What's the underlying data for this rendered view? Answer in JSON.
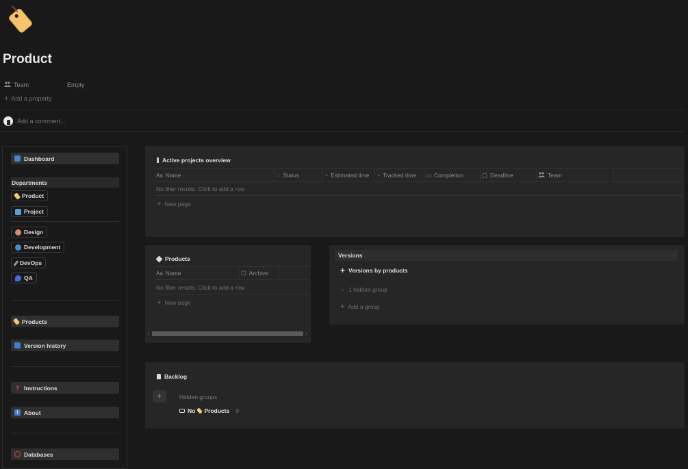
{
  "page": {
    "icon": "tag-icon",
    "title": "Product",
    "properties": [
      {
        "label": "Team",
        "value": "Empty",
        "icon": "people-icon"
      }
    ],
    "add_property": "Add a property",
    "comment_placeholder": "Add a comment..."
  },
  "sidebar": {
    "dashboard": "Dashboard",
    "departments_label": "Departments",
    "departments": [
      {
        "label": "Product",
        "icon": "tag-icon"
      },
      {
        "label": "Project",
        "icon": "chart-icon"
      },
      {
        "label": "Design",
        "icon": "palette-icon"
      },
      {
        "label": "Development",
        "icon": "globe-icon"
      },
      {
        "label": "DevOps",
        "icon": "wrench-icon"
      },
      {
        "label": "QA",
        "icon": "pin-icon"
      }
    ],
    "products": "Products",
    "version_history": "Version history",
    "instructions": "Instructions",
    "about": "About",
    "databases": "Databases"
  },
  "active_projects": {
    "title": "Active projects overview",
    "columns": [
      "Name",
      "Status",
      "Estimated time",
      "Tracked time",
      "Completion",
      "Deadline",
      "Team"
    ],
    "empty_text": "No filter results. Click to add a row.",
    "new_page": "New page"
  },
  "products_table": {
    "title": "Products",
    "columns": [
      "Name",
      "Archive"
    ],
    "empty_text": "No filter results. Click to add a row.",
    "new_page": "New page"
  },
  "versions": {
    "title": "Versions",
    "view_label": "Versions by products",
    "hidden_group": "1 hidden group",
    "add_group": "Add a group"
  },
  "backlog": {
    "title": "Backlog",
    "hidden_groups": "Hidden groups",
    "group_no": "No",
    "group_products": "Products",
    "group_count": "0"
  },
  "colors": {
    "background": "#191919",
    "panel": "#262626",
    "button": "#2f2f2f",
    "tag": "#f5c46b"
  }
}
